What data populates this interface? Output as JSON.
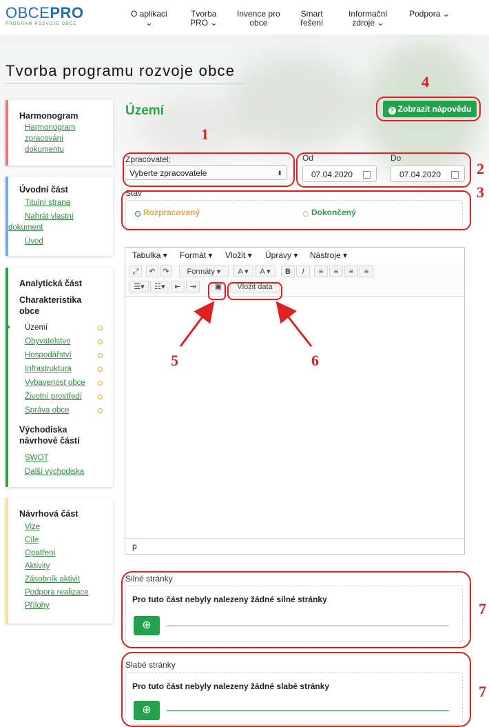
{
  "logo": {
    "obce": "OBCE",
    "pro": "PRO",
    "tagline": "PROGRAM ROZVOJE OBCE"
  },
  "nav": [
    {
      "l1": "O aplikaci",
      "l2": "⌄"
    },
    {
      "l1": "Tvorba",
      "l2": "PRO ⌄"
    },
    {
      "l1": "Invence pro",
      "l2": "obce"
    },
    {
      "l1": "Smart",
      "l2": "řešení"
    },
    {
      "l1": "Informační",
      "l2": "zdroje ⌄"
    },
    {
      "l1": "Podpora ⌄",
      "l2": ""
    }
  ],
  "page_title": "Tvorba programu rozvoje obce",
  "sidebar": {
    "harmonogram": {
      "heading": "Harmonogram",
      "link": [
        "Harmonogram",
        "zpracování",
        "dokumentu"
      ]
    },
    "uvodni": {
      "heading": "Úvodní část",
      "items": [
        "Titulní strana",
        "Nahrát vlastní",
        "dokument",
        "Úvod"
      ]
    },
    "analyticka": {
      "heading": "Analytická část",
      "sub1": [
        "Charakteristika",
        "obce"
      ],
      "items": [
        "Území",
        "Obyvatelstvo",
        "Hospodářství",
        "Infrastruktura",
        "Vybavenost obce",
        "Životní prostředí",
        "Správa obce"
      ],
      "sub2": [
        "Východiska",
        "návrhové části"
      ],
      "items2": [
        "SWOT",
        "Další východiska"
      ]
    },
    "navrhova": {
      "heading": "Návrhová část",
      "items": [
        "Vize",
        "Cíle",
        "Opatření",
        "Aktivity",
        "Zásobník aktivit",
        "Podpora realizace",
        "Přílohy"
      ]
    }
  },
  "main": {
    "section_title": "Území",
    "help_button": "Zobrazit nápovědu",
    "zpracovatel_label": "Zpracovatel:",
    "zpracovatel_value": "Vyberte zpracovatele",
    "od_label": "Od",
    "od_value": "07.04.2020",
    "do_label": "Do",
    "do_value": "07.04.2020",
    "stav_label": "Stav",
    "stav_option1": "Rozpracovaný",
    "stav_option2": "Dokončený"
  },
  "editor": {
    "menu": [
      "Tabulka ▾",
      "Formát ▾",
      "Vložit ▾",
      "Úpravy ▾",
      "Nástroje ▾"
    ],
    "formaty": "Formáty ▾",
    "insert_data": "Vložit data",
    "status": "p"
  },
  "strong": {
    "title": "Silné stránky",
    "empty": "Pro tuto část nebyly nalezeny žádné silné stránky"
  },
  "weak": {
    "title": "Slabé stránky",
    "empty": "Pro tuto část nebyly nalezeny žádné slabé stránky"
  },
  "annotations": [
    "1",
    "2",
    "3",
    "4",
    "5",
    "6",
    "7",
    "7"
  ],
  "colors": {
    "accent_green": "#23a24d",
    "link_green": "#2f8f3f",
    "annotation_red": "#e02020",
    "logo_blue": "#1d70b8",
    "status_orange": "#e5a83a"
  }
}
